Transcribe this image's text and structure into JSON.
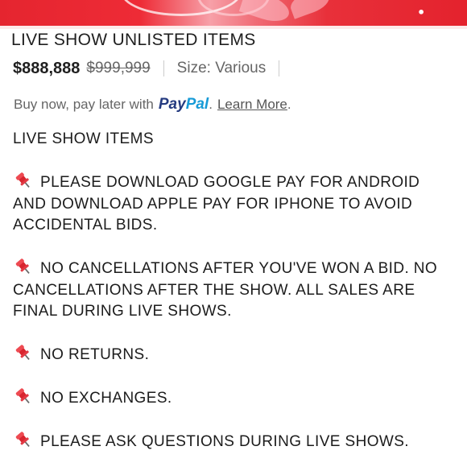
{
  "listing": {
    "title": "LIVE SHOW UNLISTED ITEMS",
    "price": "$888,888",
    "original_price": "$999,999",
    "size_label": "Size: Various"
  },
  "paypal": {
    "prefix": "Buy now, pay later with",
    "logo_part1": "Pay",
    "logo_part2": "Pal",
    "period": ".",
    "learn_more": "Learn More",
    "learn_more_period": "."
  },
  "description": {
    "heading": "LIVE SHOW ITEMS",
    "items": [
      "PLEASE DOWNLOAD GOOGLE PAY FOR ANDROID AND DOWNLOAD APPLE PAY FOR IPHONE TO AVOID ACCIDENTAL BIDS.",
      "NO CANCELLATIONS AFTER YOU'VE WON A BID. NO CANCELLATIONS AFTER THE SHOW. ALL SALES ARE FINAL DURING LIVE SHOWS.",
      "NO RETURNS.",
      "NO EXCHANGES.",
      "PLEASE ASK QUESTIONS DURING LIVE SHOWS."
    ],
    "item_icon": "pushpin-icon"
  },
  "colors": {
    "banner_red": "#e5252f",
    "paypal_dark": "#253b80",
    "paypal_light": "#179bd7",
    "text": "#1c1c1c",
    "muted": "#666666"
  }
}
